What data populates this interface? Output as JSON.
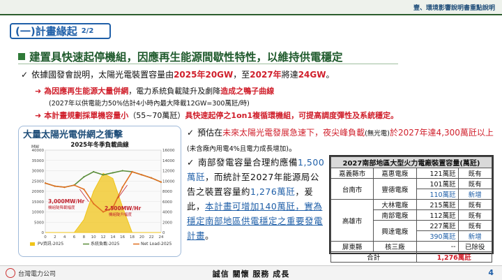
{
  "header_note": "壹、環境影響說明書重點說明",
  "section": {
    "title": "(一)計畫緣起",
    "page": "2/2"
  },
  "headline": "建置具快速起停機組，因應再生能源間歇性特性，以維持供電穩定",
  "bullet1": {
    "t1": "依據國發會說明，太陽光電裝置容量由",
    "v1": "2025年20GW",
    "t2": "，至",
    "v2": "2027年",
    "t3": "將達",
    "v3": "24GW",
    "t4": "。"
  },
  "sub1": {
    "r1": "為因應再生能源大量併網",
    "t1": "，電力系統負載陡升及劇降",
    "r2": "造成之鴨子曲線",
    "note": "(2027年以供電能力50%估計4小時內最大降載12GW=300萬瓩/時)"
  },
  "sub2": {
    "r1": "本計畫規劃採單機容量小",
    "t1": "（55~70萬瓩）",
    "r2": "具快速起停之1on1複循環機組，可提高調度彈性及系統穩定。"
  },
  "chart_data": {
    "type": "line",
    "title": "大量太陽光電併網之衝擊",
    "subtitle": "2025年冬季負載曲線",
    "ylabel": "MW",
    "ylim_left": [
      0,
      40000
    ],
    "ylim_right": [
      0,
      16000
    ],
    "x": [
      0,
      2,
      4,
      6,
      8,
      10,
      12,
      14,
      16,
      18,
      20,
      22,
      24
    ],
    "xticks": [
      "0",
      "2",
      "4",
      "6",
      "8",
      "10",
      "12",
      "14",
      "16",
      "18",
      "20",
      "22",
      "24"
    ],
    "yticks_left": [
      "0",
      "5000",
      "10000",
      "15000",
      "20000",
      "25000",
      "30000",
      "35000",
      "40000"
    ],
    "yticks_right": [
      "0",
      "2000",
      "4000",
      "6000",
      "8000",
      "10000",
      "12000",
      "14000",
      "16000"
    ],
    "series": [
      {
        "name": "PV資訊-2025",
        "axis": "right",
        "color": "#f0c419",
        "values": [
          0,
          0,
          0,
          0,
          2500,
          8000,
          11500,
          10500,
          5000,
          0,
          0,
          0,
          0
        ]
      },
      {
        "name": "系統負載-2025",
        "axis": "left",
        "color": "#5a8d3a",
        "values": [
          24000,
          22500,
          22000,
          23000,
          27000,
          29500,
          28000,
          29000,
          30000,
          29500,
          28000,
          26500,
          24500
        ]
      },
      {
        "name": "Net Load-2025",
        "axis": "left",
        "color": "#e07020",
        "values": [
          24000,
          22500,
          22000,
          23000,
          21000,
          14000,
          10000,
          12000,
          22000,
          29500,
          28000,
          26500,
          24500
        ]
      }
    ],
    "annotations": [
      {
        "value": "3,000",
        "unit": "MW/Hr",
        "caption": "機組陡降載幅度"
      },
      {
        "value": "2,500",
        "unit": "MW/Hr",
        "caption": "機組陡升幅度"
      }
    ]
  },
  "bullet2": {
    "t1": "預估在",
    "r1": "未來太陽光電發展急速下，夜尖峰負載",
    "s1": "(無光電)",
    "r2": "於2027年達4,300萬瓩以上",
    "s2": "(未含廠內用電4%且電力成長增加)",
    "t2": "。"
  },
  "para2": {
    "t1": "南部發電容量合理約應備",
    "b1": "1,500萬瓩",
    "t2": "，而統計至2027年能源局公告之裝置容量約",
    "b2": "1,276萬瓩",
    "t3": "，爰此，",
    "b3": "本計畫可增加140萬瓩，實為穩定南部地區供電穩定之重要發電計畫",
    "t4": "。"
  },
  "table": {
    "title": "2027南部地區大型火力電廠裝置容量(萬瓩)",
    "head": [
      "嘉義縣市",
      "嘉惠電廠",
      "121萬瓩",
      "既有"
    ],
    "rows": [
      {
        "region": "台南市",
        "plant": "豐德電廠",
        "cap": "101萬瓩",
        "status": "既有"
      },
      {
        "cap": "110萬瓩",
        "status": "新增"
      },
      {
        "region": "高雄市",
        "plant": "大林電廠",
        "cap": "215萬瓩",
        "status": "既有"
      },
      {
        "plant": "南部電廠",
        "cap": "112萬瓩",
        "status": "既有"
      },
      {
        "plant": "興達電廠",
        "cap": "227萬瓩",
        "status": "既有"
      },
      {
        "cap": "390萬瓩",
        "status": "新增"
      },
      {
        "region": "屏東縣",
        "plant": "核三廠",
        "cap": "--",
        "status": "已除役"
      }
    ],
    "total_label": "合計",
    "total_value": "1,276萬瓩"
  },
  "footer": {
    "company": "台灣電力公司",
    "slogan": "誠信 關懷 服務 成長",
    "page": "4"
  }
}
